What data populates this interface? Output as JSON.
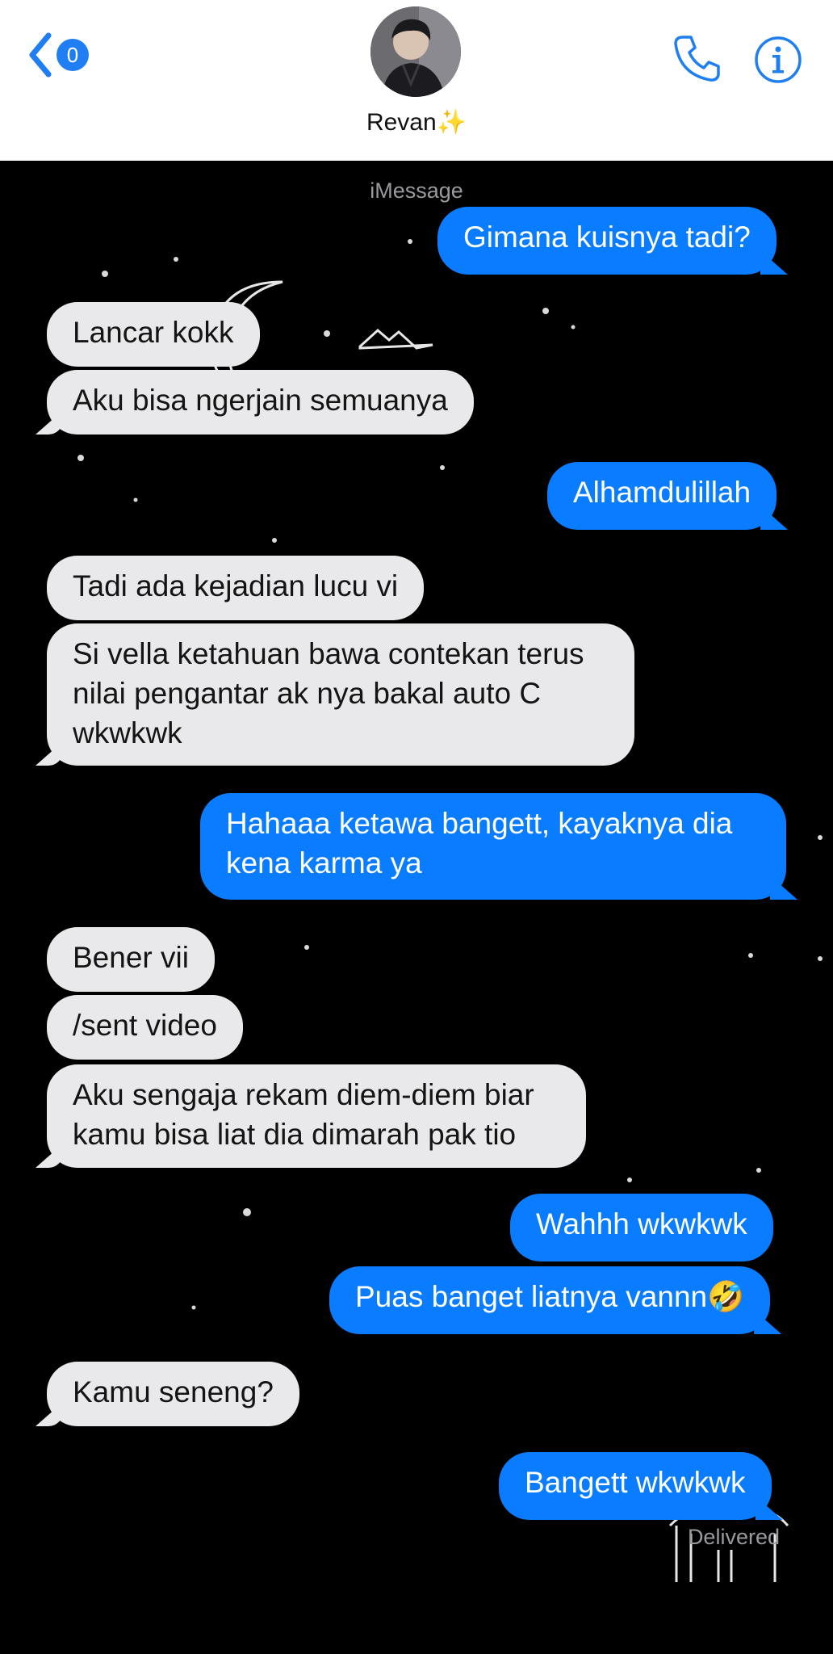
{
  "header": {
    "back_badge": "0",
    "contact_name": "Revan",
    "contact_emoji": "✨"
  },
  "chat": {
    "service_label": "iMessage",
    "messages": [
      {
        "from": "me",
        "text": "Gimana kuisnya tadi?"
      },
      {
        "from": "them",
        "text": "Lancar kokk"
      },
      {
        "from": "them",
        "text": "Aku bisa ngerjain semuanya"
      },
      {
        "from": "me",
        "text": "Alhamdulillah"
      },
      {
        "from": "them",
        "text": "Tadi ada kejadian lucu vi"
      },
      {
        "from": "them",
        "text": "Si vella ketahuan bawa contekan terus nilai pengantar ak nya bakal auto C wkwkwk"
      },
      {
        "from": "me",
        "text": "Hahaaa ketawa bangett, kayaknya dia kena karma ya"
      },
      {
        "from": "them",
        "text": "Bener vii"
      },
      {
        "from": "them",
        "text": "/sent video"
      },
      {
        "from": "them",
        "text": "Aku sengaja rekam diem-diem biar kamu bisa liat dia dimarah pak tio"
      },
      {
        "from": "me",
        "text": "Wahhh wkwkwk"
      },
      {
        "from": "me",
        "text": "Puas banget liatnya vannn🤣"
      },
      {
        "from": "them",
        "text": "Kamu seneng?"
      },
      {
        "from": "me",
        "text": "Bangett wkwkwk"
      }
    ],
    "status": "Delivered"
  },
  "colors": {
    "accent": "#0a7cff",
    "incoming_bubble": "#e9e9eb",
    "background": "#000000"
  }
}
